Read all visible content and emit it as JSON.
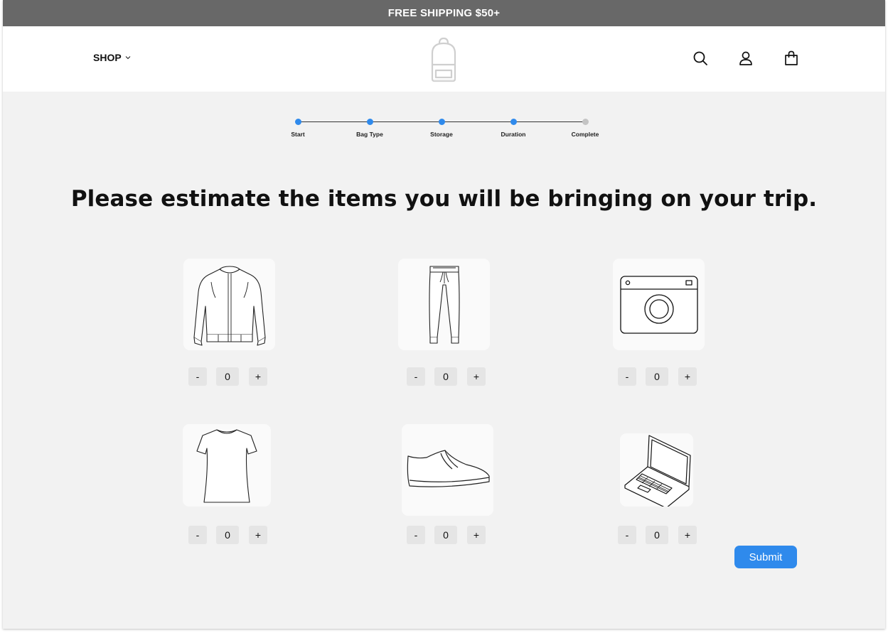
{
  "promo": {
    "text": "FREE SHIPPING $50+"
  },
  "header": {
    "shop_label": "SHOP",
    "icons": [
      "backpack-logo",
      "search-icon",
      "account-icon",
      "shopping-bag-icon"
    ]
  },
  "progress": {
    "steps": [
      {
        "label": "Start",
        "complete": true
      },
      {
        "label": "Bag Type",
        "complete": true
      },
      {
        "label": "Storage",
        "complete": true
      },
      {
        "label": "Duration",
        "complete": true
      },
      {
        "label": "Complete",
        "complete": false
      }
    ],
    "active_color": "#2f8aec",
    "inactive_color": "#c4c4c4"
  },
  "main": {
    "title": "Please estimate the items you will be bringing on your trip.",
    "items": [
      {
        "icon": "jacket-icon",
        "minus": "-",
        "value": "0",
        "plus": "+"
      },
      {
        "icon": "pants-icon",
        "minus": "-",
        "value": "0",
        "plus": "+"
      },
      {
        "icon": "camera-icon",
        "minus": "-",
        "value": "0",
        "plus": "+"
      },
      {
        "icon": "tshirt-icon",
        "minus": "-",
        "value": "0",
        "plus": "+"
      },
      {
        "icon": "shoe-icon",
        "minus": "-",
        "value": "0",
        "plus": "+"
      },
      {
        "icon": "laptop-icon",
        "minus": "-",
        "value": "0",
        "plus": "+"
      }
    ],
    "submit_label": "Submit"
  },
  "colors": {
    "promo_bg": "#686868",
    "page_bg": "#f2f2f2",
    "accent": "#2f8aec"
  }
}
